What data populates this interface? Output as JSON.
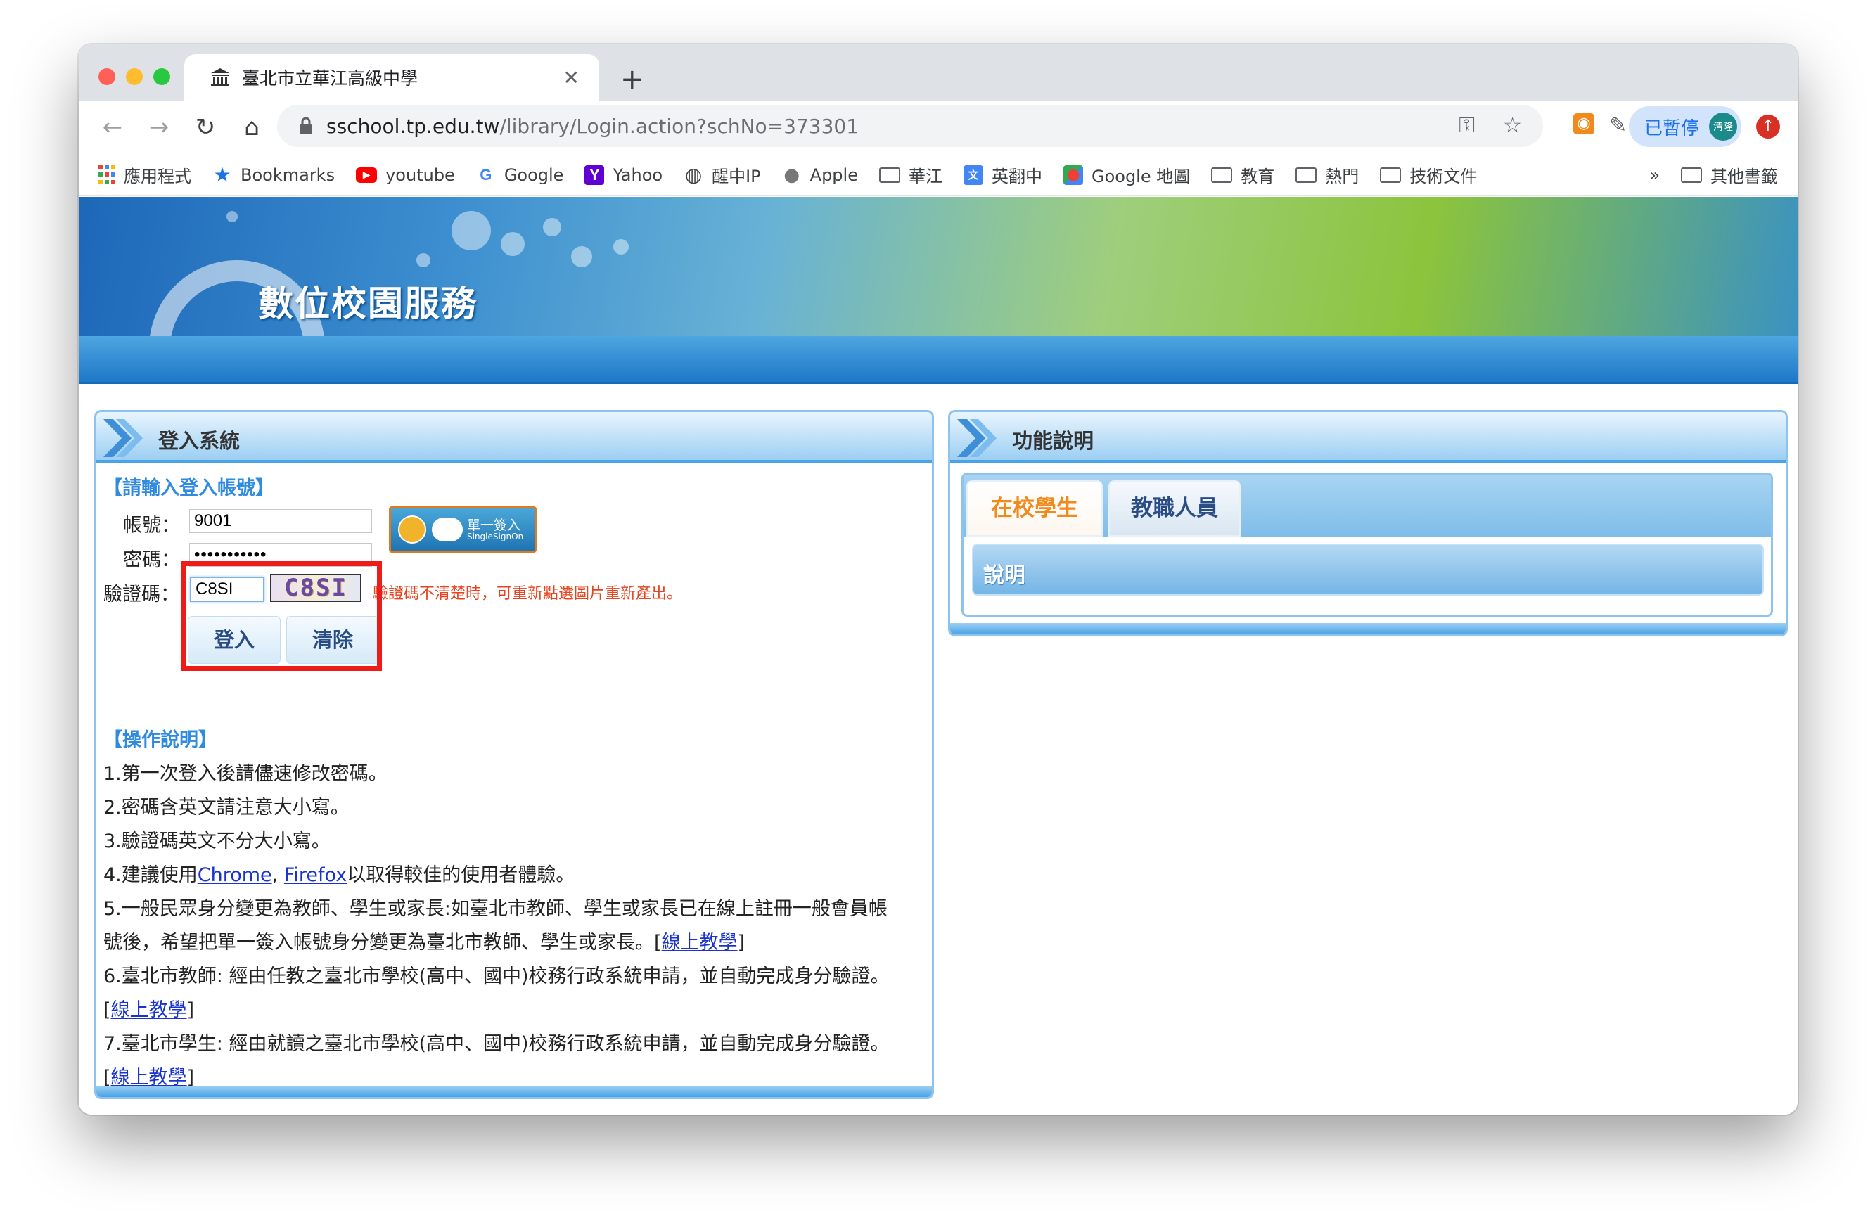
{
  "browser": {
    "tab_title": "臺北市立華江高級中學",
    "url_host": "sschool.tp.edu.tw",
    "url_path": "/library/Login.action?schNo=373301",
    "profile_label": "已暫停",
    "avatar_text": "清隆",
    "bookmarks": [
      {
        "label": "應用程式",
        "icon": "apps-grid-icon"
      },
      {
        "label": "Bookmarks",
        "icon": "star-icon"
      },
      {
        "label": "youtube",
        "icon": "youtube-icon"
      },
      {
        "label": "Google",
        "icon": "google-icon"
      },
      {
        "label": "Yahoo",
        "icon": "yahoo-icon"
      },
      {
        "label": "醒中IP",
        "icon": "globe-icon"
      },
      {
        "label": "Apple",
        "icon": "apple-icon"
      },
      {
        "label": "華江",
        "icon": "folder-icon"
      },
      {
        "label": "英翻中",
        "icon": "translate-icon"
      },
      {
        "label": "Google 地圖",
        "icon": "maps-icon"
      },
      {
        "label": "教育",
        "icon": "folder-icon"
      },
      {
        "label": "熱門",
        "icon": "folder-icon"
      },
      {
        "label": "技術文件",
        "icon": "folder-icon"
      }
    ],
    "bookmarks_overflow": "»",
    "other_bookmarks": "其他書籤"
  },
  "site": {
    "banner_title": "數位校園服務"
  },
  "login": {
    "panel_title": "登入系統",
    "prompt": "【請輸入登入帳號】",
    "account_label": "帳號：",
    "account_value": "9001",
    "password_label": "密碼：",
    "password_value": "•••••••••••",
    "captcha_label": "驗證碼：",
    "captcha_value": "C8SI",
    "captcha_image_text": "C8SI",
    "captcha_hint": "驗證碼不清楚時，可重新點選圖片重新產出。",
    "sso_line1": "單一簽入",
    "sso_line2": "SingleSignOn",
    "login_button": "登入",
    "clear_button": "清除"
  },
  "instructions": {
    "title": "【操作說明】",
    "item1": "1.第一次登入後請儘速修改密碼。",
    "item2": "2.密碼含英文請注意大小寫。",
    "item3": "3.驗證碼英文不分大小寫。",
    "item4_prefix": "4.建議使用",
    "item4_chrome": "Chrome",
    "item4_sep": ", ",
    "item4_firefox": "Firefox",
    "item4_suffix": "以取得較佳的使用者體驗。",
    "item5_line1": "5.一般民眾身分變更為教師、學生或家長:如臺北市教師、學生或家長已在線上註冊一般會員帳",
    "item5_line2": "號後，希望把單一簽入帳號身分變更為臺北市教師、學生或家長。[",
    "item6_line1": "6.臺北市教師: 經由任教之臺北市學校(高中、國中)校務行政系統申請，並自動完成身分驗證。",
    "item7_line1": "7.臺北市學生: 經由就讀之臺北市學校(高中、國中)校務行政系統申請，並自動完成身分驗證。",
    "tutorial_link": "線上教學",
    "bracket_open": "[",
    "bracket_close": "]"
  },
  "functions": {
    "panel_title": "功能說明",
    "tab_students": "在校學生",
    "tab_staff": "教職人員",
    "explain_label": "說明"
  },
  "colors": {
    "accent_orange": "#f08a1c",
    "link_blue": "#1a33cc",
    "highlight_red": "#ee1c18",
    "panel_border": "#8dc3ec"
  }
}
